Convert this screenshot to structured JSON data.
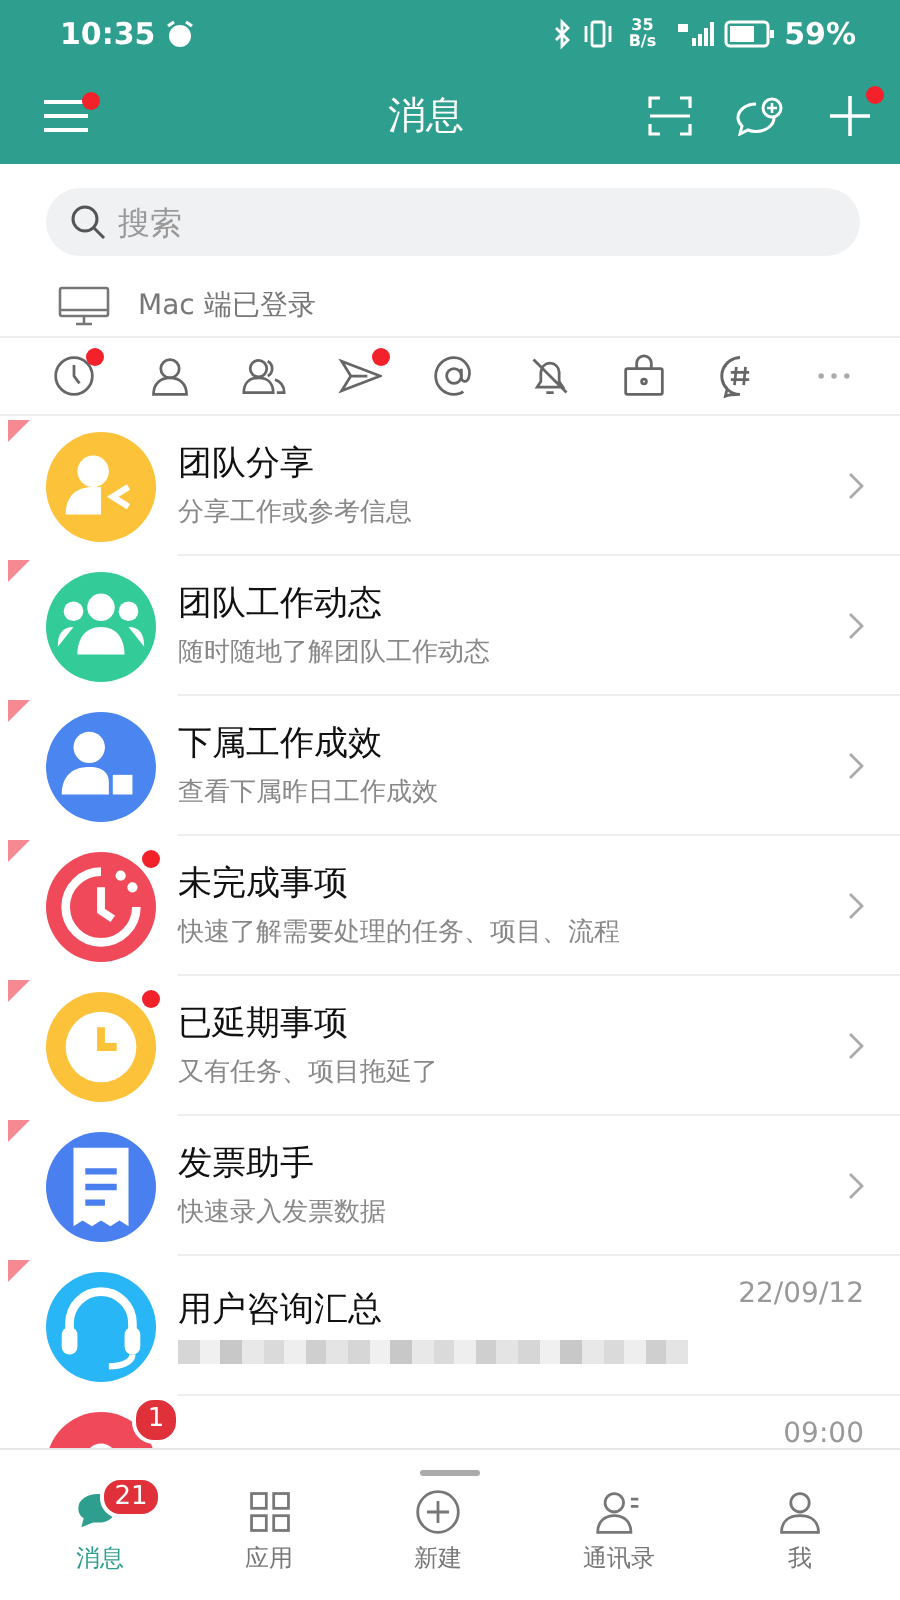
{
  "status_bar": {
    "time": "10:35",
    "net_speed": [
      "35",
      "B/s"
    ],
    "battery": "59%"
  },
  "header": {
    "title": "消息",
    "menu_dot": true,
    "add_dot": true
  },
  "search": {
    "placeholder": "搜索"
  },
  "device_notice": "Mac 端已登录",
  "filters": [
    {
      "kind": "clock",
      "dot": true
    },
    {
      "kind": "person",
      "dot": false
    },
    {
      "kind": "people",
      "dot": false
    },
    {
      "kind": "send",
      "dot": true
    },
    {
      "kind": "at",
      "dot": false
    },
    {
      "kind": "mute",
      "dot": false
    },
    {
      "kind": "lock",
      "dot": false
    },
    {
      "kind": "hashtag",
      "dot": false
    },
    {
      "kind": "more",
      "dot": false
    }
  ],
  "messages": [
    {
      "kind": "share",
      "color": "#fcc23a",
      "title": "团队分享",
      "subtitle": "分享工作或参考信息",
      "dot": false,
      "pinned": true
    },
    {
      "kind": "team",
      "color": "#33cc99",
      "title": "团队工作动态",
      "subtitle": "随时随地了解团队工作动态",
      "dot": false,
      "pinned": true
    },
    {
      "kind": "subordinate",
      "color": "#4a85f0",
      "title": "下属工作成效",
      "subtitle": "查看下属昨日工作成效",
      "dot": false,
      "pinned": true
    },
    {
      "kind": "overdue",
      "color": "#f04a5a",
      "title": "未完成事项",
      "subtitle": "快速了解需要处理的任务、项目、流程",
      "dot": true,
      "pinned": true
    },
    {
      "kind": "clock",
      "color": "#fcc23a",
      "title": "已延期事项",
      "subtitle": "又有任务、项目拖延了",
      "dot": true,
      "pinned": true
    },
    {
      "kind": "receipt",
      "color": "#4a7ff0",
      "title": "发票助手",
      "subtitle": "快速录入发票数据",
      "dot": false,
      "pinned": true
    },
    {
      "kind": "headset",
      "color": "#29b6f6",
      "title": "用户咨询汇总",
      "time": "22/09/12",
      "blurred": true,
      "pinned": true
    },
    {
      "kind": "bell",
      "color": "#f04a5a",
      "time": "09:00",
      "badge": "1",
      "pinned": false
    }
  ],
  "nav": [
    {
      "kind": "chat",
      "label": "消息",
      "badge": "21",
      "selected": true
    },
    {
      "kind": "apps",
      "label": "应用",
      "selected": false
    },
    {
      "kind": "new",
      "label": "新建",
      "selected": false
    },
    {
      "kind": "contacts",
      "label": "通讯录",
      "selected": false
    },
    {
      "kind": "me",
      "label": "我",
      "selected": false
    }
  ]
}
